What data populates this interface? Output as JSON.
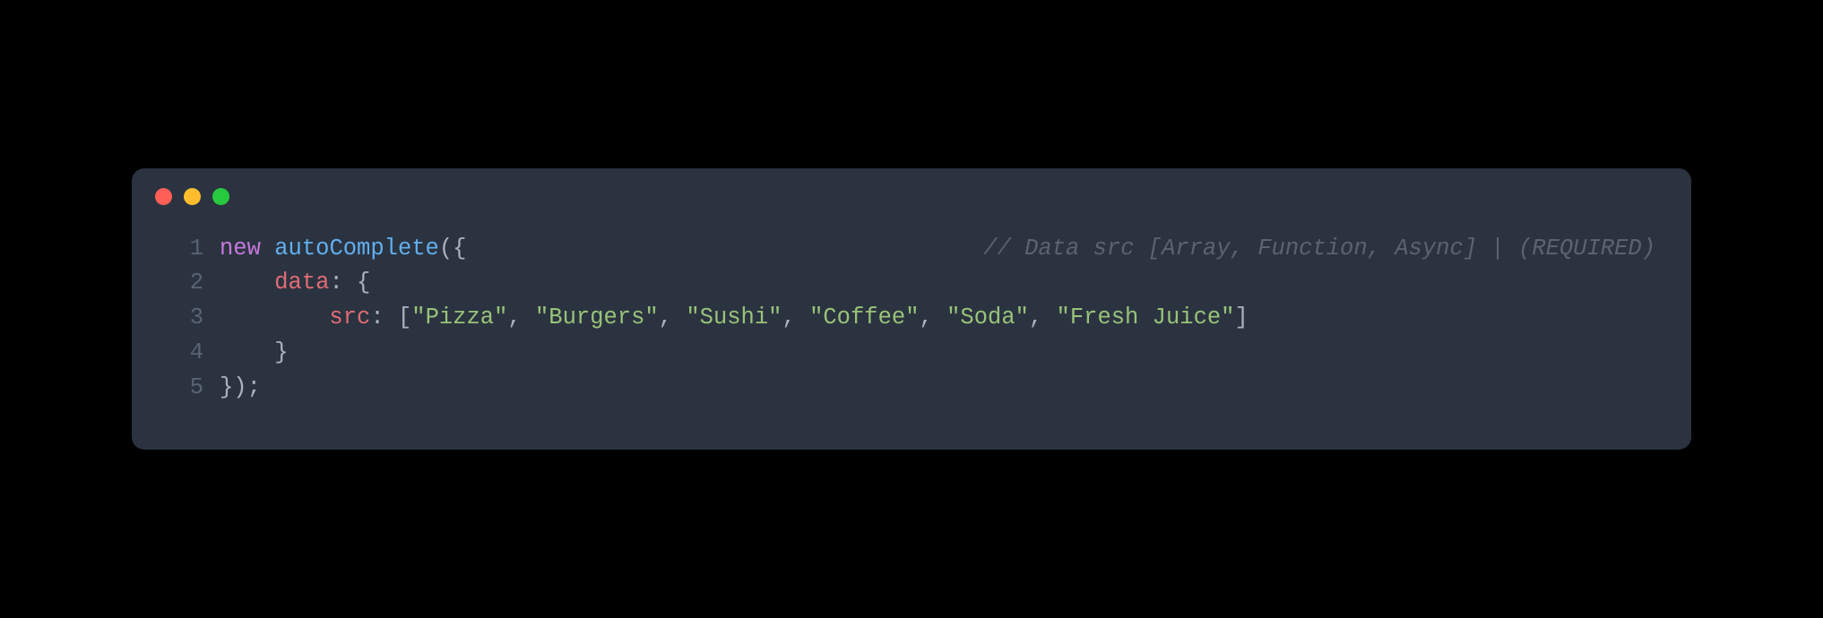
{
  "traffic_lights": {
    "close": "red",
    "minimize": "yellow",
    "zoom": "green"
  },
  "code": {
    "line_numbers": [
      "1",
      "2",
      "3",
      "4",
      "5"
    ],
    "line1": {
      "keyword": "new",
      "fn": "autoComplete",
      "open": "({",
      "comment": "// Data src [Array, Function, Async] | (REQUIRED)"
    },
    "line2": {
      "indent": "    ",
      "prop": "data",
      "colon": ": {"
    },
    "line3": {
      "indent": "        ",
      "prop": "src",
      "colon": ": [",
      "s1": "\"Pizza\"",
      "c1": ", ",
      "s2": "\"Burgers\"",
      "c2": ", ",
      "s3": "\"Sushi\"",
      "c3": ", ",
      "s4": "\"Coffee\"",
      "c4": ", ",
      "s5": "\"Soda\"",
      "c5": ", ",
      "s6": "\"Fresh Juice\"",
      "close": "]"
    },
    "line4": {
      "indent": "    ",
      "close": "}"
    },
    "line5": {
      "close": "});"
    }
  }
}
